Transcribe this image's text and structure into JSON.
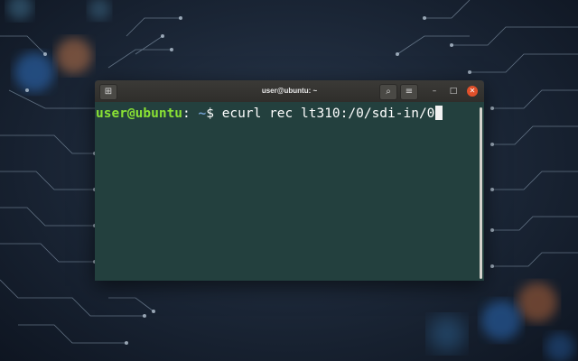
{
  "window": {
    "title": "user@ubuntu: ~",
    "new_tab_icon": "new-tab-icon",
    "search_icon": "search-icon",
    "menu_icon": "hamburger-icon",
    "minimize_icon": "minimize-icon",
    "maximize_icon": "maximize-icon",
    "close_icon": "close-icon"
  },
  "terminal": {
    "prompt_user": "user@ubuntu",
    "prompt_sep": ":",
    "prompt_path": " ~",
    "prompt_symbol": "$ ",
    "command": "ecurl rec lt310:/0/sdi-in/0"
  },
  "colors": {
    "terminal_bg": "#23403e",
    "prompt_user": "#8ae234",
    "prompt_path": "#729fcf",
    "titlebar": "#2f2e2b",
    "close_button": "#e0502a"
  }
}
